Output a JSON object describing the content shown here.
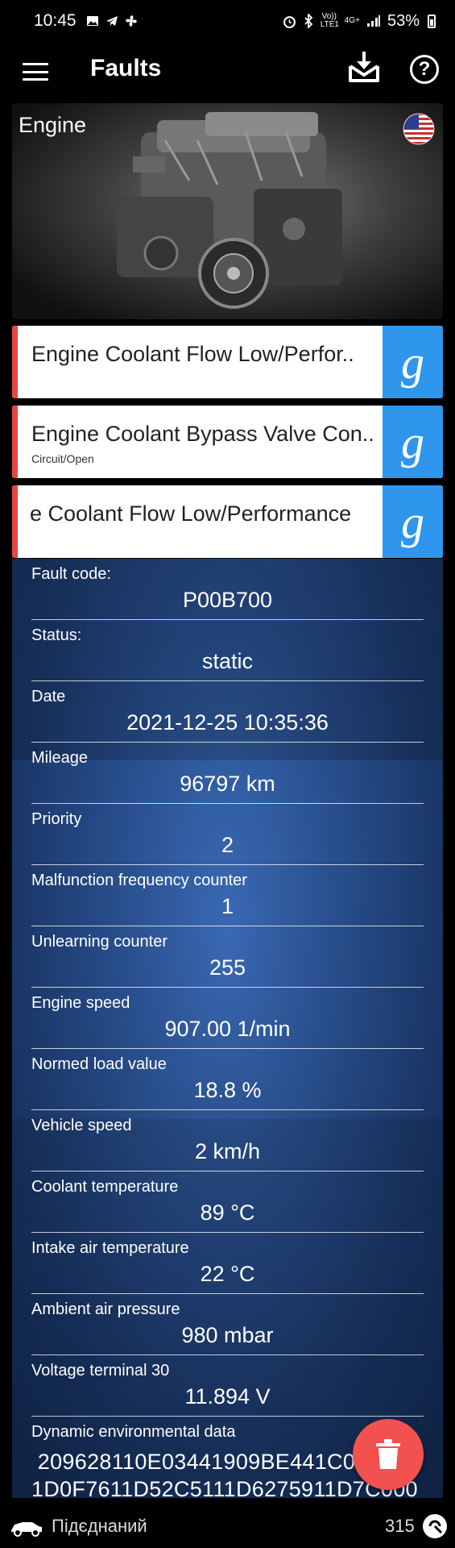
{
  "status_bar": {
    "time": "10:45",
    "left_icons": [
      "image-icon",
      "telegram-icon",
      "fan-icon"
    ],
    "right_icons": [
      "alarm-icon",
      "bluetooth-icon",
      "volte-icon",
      "4g-icon",
      "signal-icon"
    ],
    "volte_text": "Vo)) LTE1",
    "network_text": "4G+",
    "battery": "53%"
  },
  "app_bar": {
    "title": "Faults"
  },
  "banner": {
    "title": "Engine",
    "flag": "us-flag-icon"
  },
  "faults": [
    {
      "text": "Engine Coolant Flow Low/Perfor..",
      "sub": ""
    },
    {
      "text": "Engine Coolant Bypass Valve Con..",
      "sub": "Circuit/Open"
    },
    {
      "text": "e Coolant Flow Low/Performance",
      "sub": ""
    }
  ],
  "details": [
    {
      "label": "Fault code:",
      "value": "P00B700"
    },
    {
      "label": "Status:",
      "value": "static"
    },
    {
      "label": "Date",
      "value": "2021-12-25 10:35:36"
    },
    {
      "label": "Mileage",
      "value": "96797 km"
    },
    {
      "label": "Priority",
      "value": "2"
    },
    {
      "label": "Malfunction frequency counter",
      "value": "1"
    },
    {
      "label": "Unlearning counter",
      "value": "255"
    },
    {
      "label": "Engine speed",
      "value": "907.00 1/min"
    },
    {
      "label": "Normed load value",
      "value": "18.8 %"
    },
    {
      "label": "Vehicle speed",
      "value": "2 km/h"
    },
    {
      "label": "Coolant temperature",
      "value": "89 °C"
    },
    {
      "label": "Intake air temperature",
      "value": "22 °C"
    },
    {
      "label": "Ambient air pressure",
      "value": "980 mbar"
    },
    {
      "label": "Voltage terminal 30",
      "value": "11.894 V"
    }
  ],
  "dynamic": {
    "label": "Dynamic environmental data",
    "line1": " 209628110E03441909BE441C0",
    "line2": "1D0F7611D52C5111D6275911D7C000"
  },
  "bottom_bar": {
    "connection": "Підєднаний",
    "count": "315"
  },
  "colors": {
    "accent_red": "#e8473e",
    "google_blue": "#2f96ee",
    "fab_red": "#f25150",
    "panel_blue": "#2c5597"
  }
}
